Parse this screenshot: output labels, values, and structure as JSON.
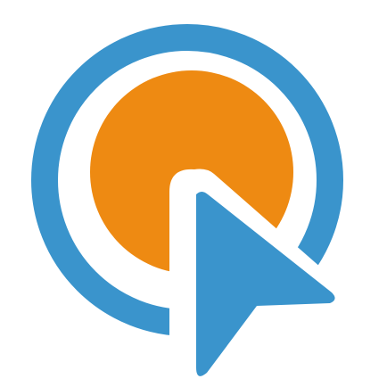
{
  "logo": {
    "icon": "target-cursor-logo-icon",
    "colors": {
      "background": "#ffffff",
      "ring": "#3a94cc",
      "disc": "#ee8a12",
      "cursor": "#3a94cc",
      "separator": "#ffffff"
    }
  }
}
